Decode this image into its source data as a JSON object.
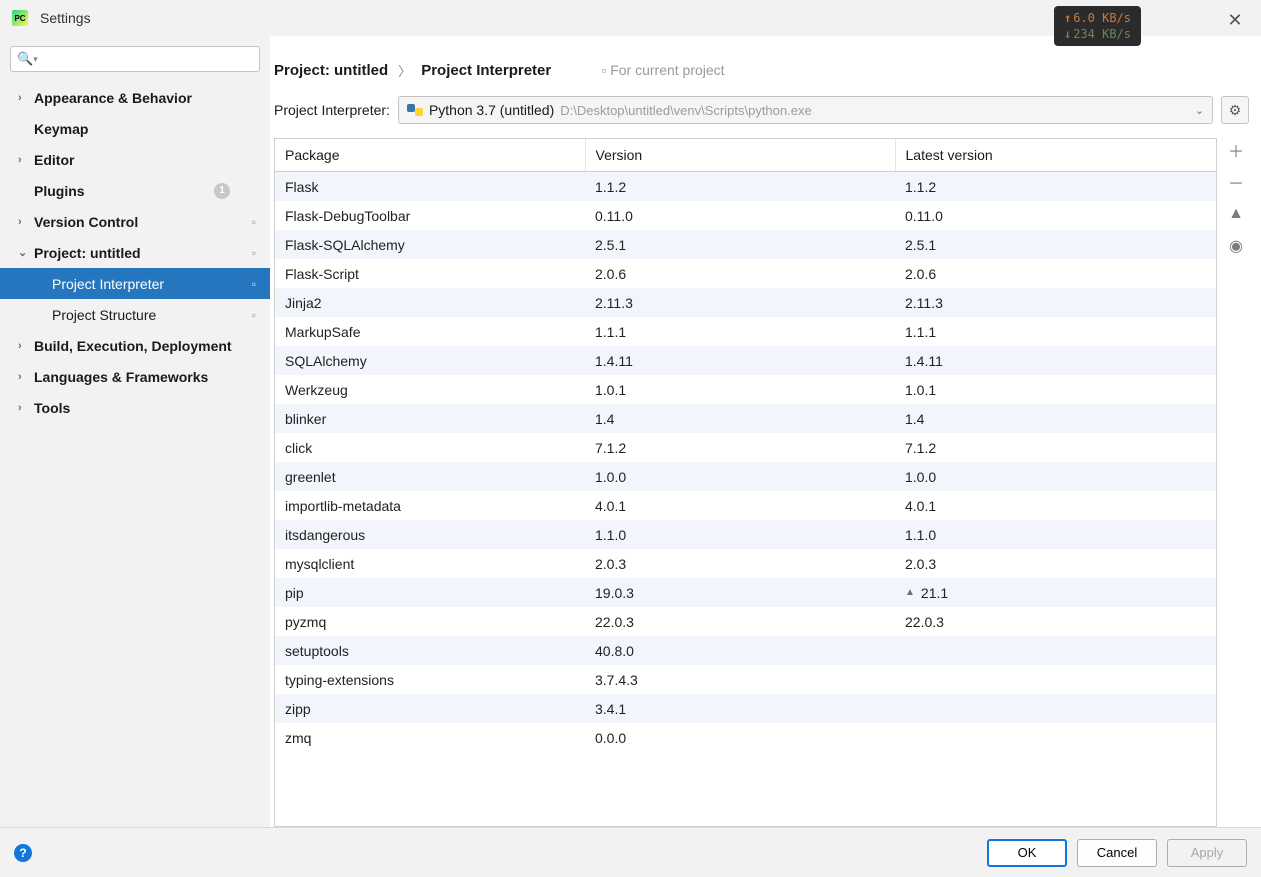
{
  "window": {
    "title": "Settings"
  },
  "net": {
    "up": "6.0 KB/s",
    "down": "234 KB/s"
  },
  "search": {
    "placeholder": ""
  },
  "sidebar": {
    "items": [
      {
        "label": "Appearance & Behavior",
        "bold": true,
        "expandable": true
      },
      {
        "label": "Keymap",
        "bold": true
      },
      {
        "label": "Editor",
        "bold": true,
        "expandable": true
      },
      {
        "label": "Plugins",
        "bold": true,
        "count": "1"
      },
      {
        "label": "Version Control",
        "bold": true,
        "expandable": true,
        "projicon": true
      },
      {
        "label": "Project: untitled",
        "bold": true,
        "expandable": true,
        "expanded": true,
        "projicon": true
      },
      {
        "label": "Project Interpreter",
        "child": true,
        "selected": true,
        "projicon": true
      },
      {
        "label": "Project Structure",
        "child": true,
        "projicon": true
      },
      {
        "label": "Build, Execution, Deployment",
        "bold": true,
        "expandable": true
      },
      {
        "label": "Languages & Frameworks",
        "bold": true,
        "expandable": true
      },
      {
        "label": "Tools",
        "bold": true,
        "expandable": true
      }
    ]
  },
  "breadcrumb": {
    "crumb1": "Project: untitled",
    "crumb2": "Project Interpreter",
    "note": "For current project"
  },
  "interpreter": {
    "label": "Project Interpreter:",
    "name": "Python 3.7 (untitled)",
    "path": "D:\\Desktop\\untitled\\venv\\Scripts\\python.exe"
  },
  "table": {
    "headers": {
      "package": "Package",
      "version": "Version",
      "latest": "Latest version"
    },
    "rows": [
      {
        "pkg": "Flask",
        "ver": "1.1.2",
        "latest": "1.1.2"
      },
      {
        "pkg": "Flask-DebugToolbar",
        "ver": "0.11.0",
        "latest": "0.11.0"
      },
      {
        "pkg": "Flask-SQLAlchemy",
        "ver": "2.5.1",
        "latest": "2.5.1"
      },
      {
        "pkg": "Flask-Script",
        "ver": "2.0.6",
        "latest": "2.0.6"
      },
      {
        "pkg": "Jinja2",
        "ver": "2.11.3",
        "latest": "2.11.3"
      },
      {
        "pkg": "MarkupSafe",
        "ver": "1.1.1",
        "latest": "1.1.1"
      },
      {
        "pkg": "SQLAlchemy",
        "ver": "1.4.11",
        "latest": "1.4.11"
      },
      {
        "pkg": "Werkzeug",
        "ver": "1.0.1",
        "latest": "1.0.1"
      },
      {
        "pkg": "blinker",
        "ver": "1.4",
        "latest": "1.4"
      },
      {
        "pkg": "click",
        "ver": "7.1.2",
        "latest": "7.1.2"
      },
      {
        "pkg": "greenlet",
        "ver": "1.0.0",
        "latest": "1.0.0"
      },
      {
        "pkg": "importlib-metadata",
        "ver": "4.0.1",
        "latest": "4.0.1"
      },
      {
        "pkg": "itsdangerous",
        "ver": "1.1.0",
        "latest": "1.1.0"
      },
      {
        "pkg": "mysqlclient",
        "ver": "2.0.3",
        "latest": "2.0.3"
      },
      {
        "pkg": "pip",
        "ver": "19.0.3",
        "latest": "21.1",
        "upgrade": true
      },
      {
        "pkg": "pyzmq",
        "ver": "22.0.3",
        "latest": "22.0.3"
      },
      {
        "pkg": "setuptools",
        "ver": "40.8.0",
        "latest": ""
      },
      {
        "pkg": "typing-extensions",
        "ver": "3.7.4.3",
        "latest": ""
      },
      {
        "pkg": "zipp",
        "ver": "3.4.1",
        "latest": ""
      },
      {
        "pkg": "zmq",
        "ver": "0.0.0",
        "latest": ""
      }
    ]
  },
  "buttons": {
    "ok": "OK",
    "cancel": "Cancel",
    "apply": "Apply"
  }
}
